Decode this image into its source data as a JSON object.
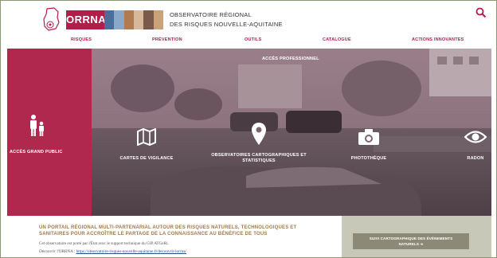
{
  "header": {
    "brand": "ORRNA",
    "org_line1": "OBSERVATOIRE RÉGIONAL",
    "org_line2": "DES RISQUES NOUVELLE-AQUITAINE"
  },
  "nav": {
    "items": [
      "RISQUES",
      "PRÉVENTION",
      "OUTILS",
      "CATALOGUE",
      "ACTIONS INNOVANTES"
    ]
  },
  "hero": {
    "grand_public_label": "ACCÈS GRAND PUBLIC",
    "pro_label": "ACCÈS PROFESSIONNEL",
    "tiles": [
      {
        "label": "CARTES DE VIGILANCE",
        "icon": "map-icon"
      },
      {
        "label_line1": "OBSERVATOIRES CARTOGRAPHIQUES ET",
        "label_line2": "STATISTIQUES",
        "icon": "map-pin-icon"
      },
      {
        "label": "PHOTOTHÈQUE",
        "icon": "camera-icon"
      },
      {
        "label": "RADON",
        "icon": "eye-icon"
      }
    ]
  },
  "intro": {
    "title_line1": "UN PORTAIL RÉGIONAL MULTI-PARTENARIAL AUTOUR DES RISQUES NATURELS, TECHNOLOGIQUES ET",
    "title_line2": "SANITAIRES POUR ACCROÎTRE LE PARTAGE DE LA CONNAISSANCE AU BÉNÉFICE DE TOUS",
    "text": "Cet observatoire est porté par l'État avec le support technique du GIP ATGeRi.",
    "discover_prefix": "Découvrir l'ORRNA :",
    "discover_link": "https://observatoire-risques-nouvelle-aquitaine.fr/decouvrir-lorrna/"
  },
  "suivi": {
    "line1": "SUIVI CARTOGRAPHIQUE DES ÉVÉNEMENTS",
    "line2": "NATURELS",
    "arrow": "➜"
  },
  "colors": {
    "brand": "#b01e4a",
    "grand_public_bg": "#b0284d",
    "title_text": "#a07848"
  }
}
